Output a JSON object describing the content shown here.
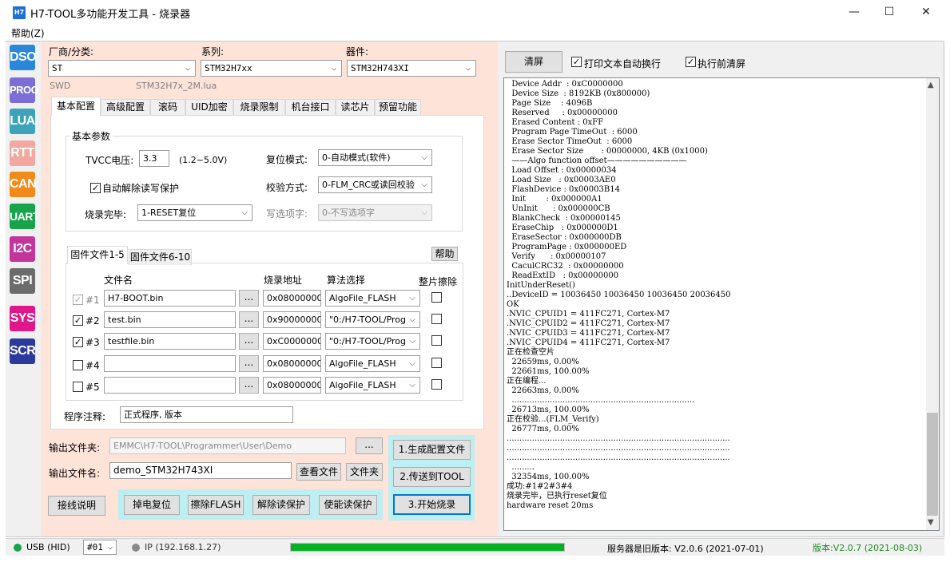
{
  "window": {
    "title": "H7-TOOL多功能开发工具 - 烧录器",
    "icon_text": "H7",
    "minimize": "—",
    "maximize": "☐",
    "close": "✕"
  },
  "menu": {
    "help": "帮助(Z)"
  },
  "sidebar": [
    "DSO",
    "PROG",
    "LUA",
    "RTT",
    "CAN",
    "UART",
    "I2C",
    "SPI",
    "SYS",
    "SCR"
  ],
  "selectors": {
    "vendor_label": "厂商/分类:",
    "vendor_value": "ST",
    "series_label": "系列:",
    "series_value": "STM32H7xx",
    "device_label": "器件:",
    "device_value": "STM32H743XI",
    "interface": "SWD",
    "algo_file": "STM32H7x_2M.lua"
  },
  "tabs": [
    "基本配置",
    "高级配置",
    "滚码",
    "UID加密",
    "烧录限制",
    "机台接口",
    "读芯片",
    "预留功能"
  ],
  "basic": {
    "group_title": "基本参数",
    "tvcc_label": "TVCC电压:",
    "tvcc_value": "3.3",
    "tvcc_range": "(1.2~5.0V)",
    "reset_mode_label": "复位模式:",
    "reset_mode_value": "0-自动模式(软件)",
    "auto_unlock_label": "自动解除读写保护",
    "verify_label": "校验方式:",
    "verify_value": "0-FLM_CRC或读回校验",
    "finish_label": "烧录完毕:",
    "finish_value": "1-RESET复位",
    "option_label": "写选项字:",
    "option_value": "0-不写选项字"
  },
  "file_tabs": {
    "tab1": "固件文件1-5",
    "tab2": "固件文件6-10",
    "help": "帮助"
  },
  "file_table": {
    "col_name": "文件名",
    "col_addr": "烧录地址",
    "col_algo": "算法选择",
    "col_erase": "整片擦除",
    "browse": "...",
    "rows": [
      {
        "num": "#1",
        "checked": "✓",
        "file": "H7-BOOT.bin",
        "addr": "0x08000000",
        "algo": "AlgoFile_FLASH"
      },
      {
        "num": "#2",
        "checked": "✓",
        "file": "test.bin",
        "addr": "0x90000000",
        "algo": "\"0:/H7-TOOL/Progra"
      },
      {
        "num": "#3",
        "checked": "✓",
        "file": "testfile.bin",
        "addr": "0xC0000000",
        "algo": "\"0:/H7-TOOL/Progra"
      },
      {
        "num": "#4",
        "checked": "",
        "file": "",
        "addr": "0x08000000",
        "algo": "AlgoFile_FLASH"
      },
      {
        "num": "#5",
        "checked": "",
        "file": "",
        "addr": "0x08000000",
        "algo": "AlgoFile_FLASH"
      }
    ]
  },
  "program_note": {
    "label": "程序注释:",
    "value": "正式程序, 版本"
  },
  "output": {
    "folder_label": "输出文件夹:",
    "folder_value": "EMMC\\H7-TOOL\\Programmer\\User\\Demo",
    "browse": "...",
    "name_label": "输出文件名:",
    "name_value": "demo_STM32H743XI",
    "view_file": "查看文件",
    "folder_btn": "文件夹"
  },
  "actions": {
    "gen_config": "1.生成配置文件",
    "send_tool": "2.传送到TOOL",
    "start": "3.开始烧录",
    "wiring": "接线说明",
    "power_reset": "掉电复位",
    "erase_flash": "擦除FLASH",
    "unlock": "解除读保护",
    "lock": "使能读保护"
  },
  "right": {
    "clear": "清屏",
    "auto_wrap": "打印文本自动换行",
    "clear_before": "执行前清屏"
  },
  "log": [
    "  Device Addr  : 0xC0000000",
    "  Device Size  : 8192KB (0x800000)",
    "  Page Size    : 4096B",
    "  Reserved     : 0x00000000",
    "  Erased Content : 0xFF",
    "  Program Page TimeOut  : 6000",
    "  Erase Sector TimeOut  : 6000",
    "  Erase Sector Size       : 00000000, 4KB (0x1000)",
    "  ——Algo function offset——————————",
    "  Load Offset : 0x00000034",
    "  Load Size   : 0x00003AE0",
    "  FlashDevice : 0x00003B14",
    "  Init        : 0x000000A1",
    "  UnInit      : 0x000000CB",
    "  BlankCheck  : 0x00000145",
    "  EraseChip   : 0x000000D1",
    "  EraseSector : 0x000000DB",
    "  ProgramPage : 0x000000ED",
    "  Verify      : 0x00000107",
    "  CaculCRC32  : 0x00000000",
    "  ReadExtID   : 0x00000000",
    "InitUnderReset()",
    "..DeviceID = 10036450 10036450 10036450 20036450",
    "OK",
    ".NVIC_CPUID1 = 411FC271, Cortex-M7",
    ".NVIC_CPUID2 = 411FC271, Cortex-M7",
    ".NVIC_CPUID3 = 411FC271, Cortex-M7",
    ".NVIC_CPUID4 = 411FC271, Cortex-M7",
    "正在检查空片",
    "  22659ms, 0.00%",
    "  22661ms, 100.00%",
    "正在编程...",
    "  22663ms, 0.00%",
    "  ........................................................................",
    "  26713ms, 100.00%",
    "正在校验...(FLM_Verify)",
    "  26777ms, 0.00%",
    "........................................................................................",
    "........................................................................................",
    "........................................................................................",
    "  .........",
    "  32354ms, 100.00%",
    "成功:#1#2#3#4",
    "烧录完毕，已执行reset复位",
    "hardware reset 20ms"
  ],
  "status": {
    "usb": "USB (HID)",
    "port": "#01",
    "ip": "IP (192.168.1.27)",
    "progress": 1.0,
    "server": "服务器是旧版本: V2.0.6 (2021-07-01)",
    "version": "版本:V2.0.7 (2021-08-03)"
  },
  "colors": {
    "sidebar_dso": "#2b88d8",
    "sidebar_prog": "#7d6ed6",
    "sidebar_lua": "#3da3b8",
    "sidebar_rtt": "#f2a7a0",
    "sidebar_can": "#f08a18",
    "sidebar_uart": "#17a34a",
    "sidebar_i2c": "#c2369c",
    "sidebar_spi": "#6b6b6b",
    "sidebar_sys": "#e0178a",
    "sidebar_scr": "#2c3a9e",
    "progress": "#06b025",
    "version_text": "#1f8a1f"
  }
}
